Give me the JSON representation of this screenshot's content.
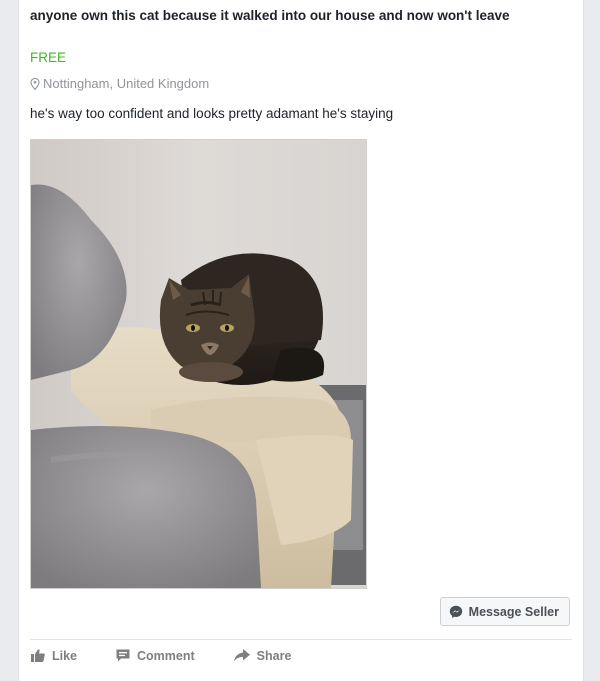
{
  "post": {
    "title": "anyone own this cat because it walked into our house and now won't leave",
    "price": "FREE",
    "location": "Nottingham, United Kingdom",
    "description": "he's way too confident and looks pretty adamant he's staying"
  },
  "buttons": {
    "message_seller": "Message Seller",
    "like": "Like",
    "comment": "Comment",
    "share": "Share"
  },
  "colors": {
    "price": "#42b72a",
    "muted_text": "#90949c",
    "action_text": "#7f7f7f",
    "page_bg": "#e9ebee"
  },
  "icons": {
    "location": "map-pin-icon",
    "messenger": "messenger-icon",
    "like": "thumbs-up-icon",
    "comment": "comment-icon",
    "share": "share-arrow-icon"
  }
}
